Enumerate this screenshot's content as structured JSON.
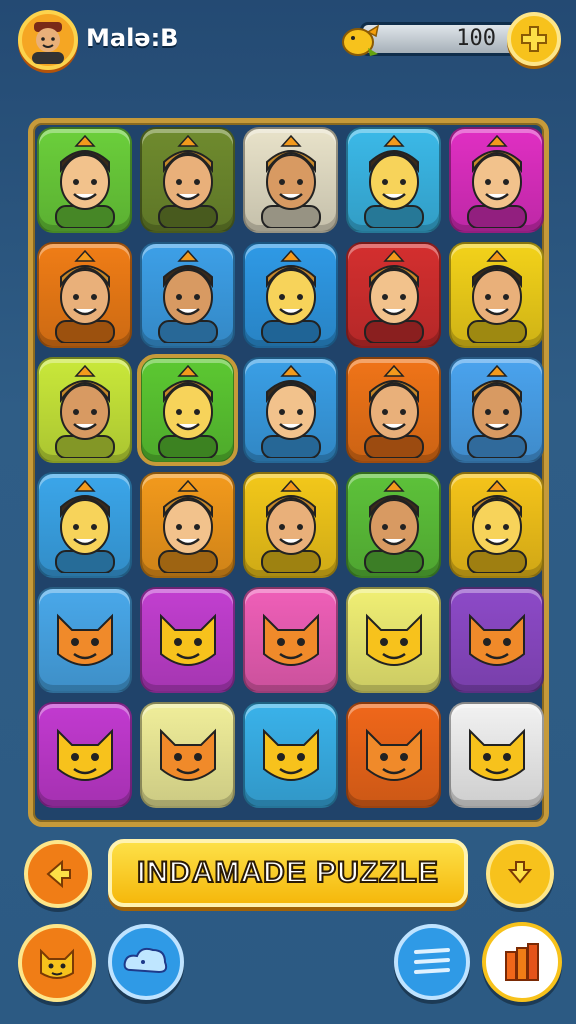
{
  "header": {
    "player_name": "Malə:B",
    "coins": "100",
    "avatar_icon": "player-avatar-icon",
    "coin_icon": "coin-creature-icon",
    "add_icon": "plus-icon"
  },
  "board": {
    "rows": 6,
    "columns": 5,
    "tiles": [
      {
        "icon": "masked-man-icon",
        "color": "#6bcf3b"
      },
      {
        "icon": "elf-face-icon",
        "color": "#6f8b2e"
      },
      {
        "icon": "curly-hair-woman-icon",
        "color": "#e8e2c9"
      },
      {
        "icon": "crowned-yellow-man-icon",
        "color": "#3bb9e8"
      },
      {
        "icon": "old-man-hat-icon",
        "color": "#e02fc3"
      },
      {
        "icon": "party-hat-man-icon",
        "color": "#f07d16"
      },
      {
        "icon": "curly-hair-man-icon",
        "color": "#3da0e8"
      },
      {
        "icon": "crowned-smiling-man-icon",
        "color": "#2f9ae6"
      },
      {
        "icon": "green-hat-man-icon",
        "color": "#d42f2f"
      },
      {
        "icon": "dark-hair-man-icon",
        "color": "#f3d21a"
      },
      {
        "icon": "grandma-icon",
        "color": "#c9e83a"
      },
      {
        "icon": "goblin-face-icon",
        "color": "#5cc832"
      },
      {
        "icon": "tiki-mask-icon",
        "color": "#3a9fe6"
      },
      {
        "icon": "blue-creature-icon",
        "color": "#f07418"
      },
      {
        "icon": "yellow-king-icon",
        "color": "#4aa3ee"
      },
      {
        "icon": "cone-hat-man-icon",
        "color": "#3ba6ea"
      },
      {
        "icon": "crowned-boy-icon",
        "color": "#f39a1c"
      },
      {
        "icon": "sunglasses-man-icon",
        "color": "#f3c81a"
      },
      {
        "icon": "palm-tree-icon",
        "color": "#5dc23a"
      },
      {
        "icon": "maroon-hat-man-icon",
        "color": "#f5c41a"
      },
      {
        "icon": "yellow-cat-icon",
        "color": "#49a8ea"
      },
      {
        "icon": "pink-elf-icon",
        "color": "#c23fd0"
      },
      {
        "icon": "orange-cat-icon",
        "color": "#ef5fb8"
      },
      {
        "icon": "smiling-cat-icon",
        "color": "#f0ef74"
      },
      {
        "icon": "wing-leaf-icon",
        "color": "#8d4ac8"
      },
      {
        "icon": "cake-rocket-icon",
        "color": "#c23ad0"
      },
      {
        "icon": "green-blob-icon",
        "color": "#f0ee9a"
      },
      {
        "icon": "seahorse-tree-icon",
        "color": "#3ab2ea"
      },
      {
        "icon": "blue-bird-brush-icon",
        "color": "#f0671a"
      },
      {
        "icon": "star-chick-icon",
        "color": "#f2f2f2"
      }
    ]
  },
  "footer": {
    "back_icon": "arrow-left-icon",
    "title": "INDAMADE PUZZLE",
    "down_icon": "arrow-down-icon",
    "cat_icon": "cat-face-icon",
    "cloud_icon": "cloud-creature-icon",
    "menu_icon": "list-lines-icon",
    "blocks_icon": "orange-blocks-icon"
  },
  "colors": {
    "background": "#2c5a83",
    "board_frame": "#c69a3a",
    "accent_yellow": "#f7c21c",
    "accent_orange": "#f07d16",
    "accent_blue": "#2f9ae6"
  }
}
